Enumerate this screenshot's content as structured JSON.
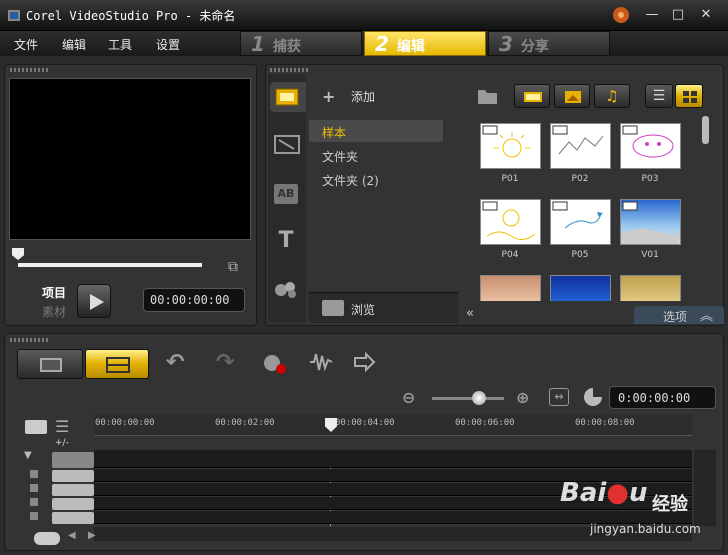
{
  "window": {
    "title": "Corel VideoStudio Pro - 未命名"
  },
  "menu": {
    "file": "文件",
    "edit": "编辑",
    "tools": "工具",
    "settings": "设置"
  },
  "steps": [
    {
      "num": "1",
      "label": "捕获"
    },
    {
      "num": "2",
      "label": "编辑"
    },
    {
      "num": "3",
      "label": "分享"
    }
  ],
  "preview": {
    "project_label": "项目",
    "clip_label": "素材",
    "timecode": "00:00:00:00"
  },
  "library": {
    "add_label": "添加",
    "folders": [
      "样本",
      "文件夹",
      "文件夹 (2)"
    ],
    "browse_label": "浏览",
    "options_label": "选项",
    "thumbs": [
      "P01",
      "P02",
      "P03",
      "P04",
      "P05",
      "V01"
    ]
  },
  "timeline": {
    "timecode": "0:00:00:00",
    "ruler": [
      "00:00:00:00",
      "00:00:02:00",
      "00:00:04:00",
      "00:00:06:00",
      "00:00:08:00"
    ],
    "add_remove": "+/-"
  },
  "watermark": {
    "text": "经验",
    "url": "jingyan.baidu.com"
  }
}
